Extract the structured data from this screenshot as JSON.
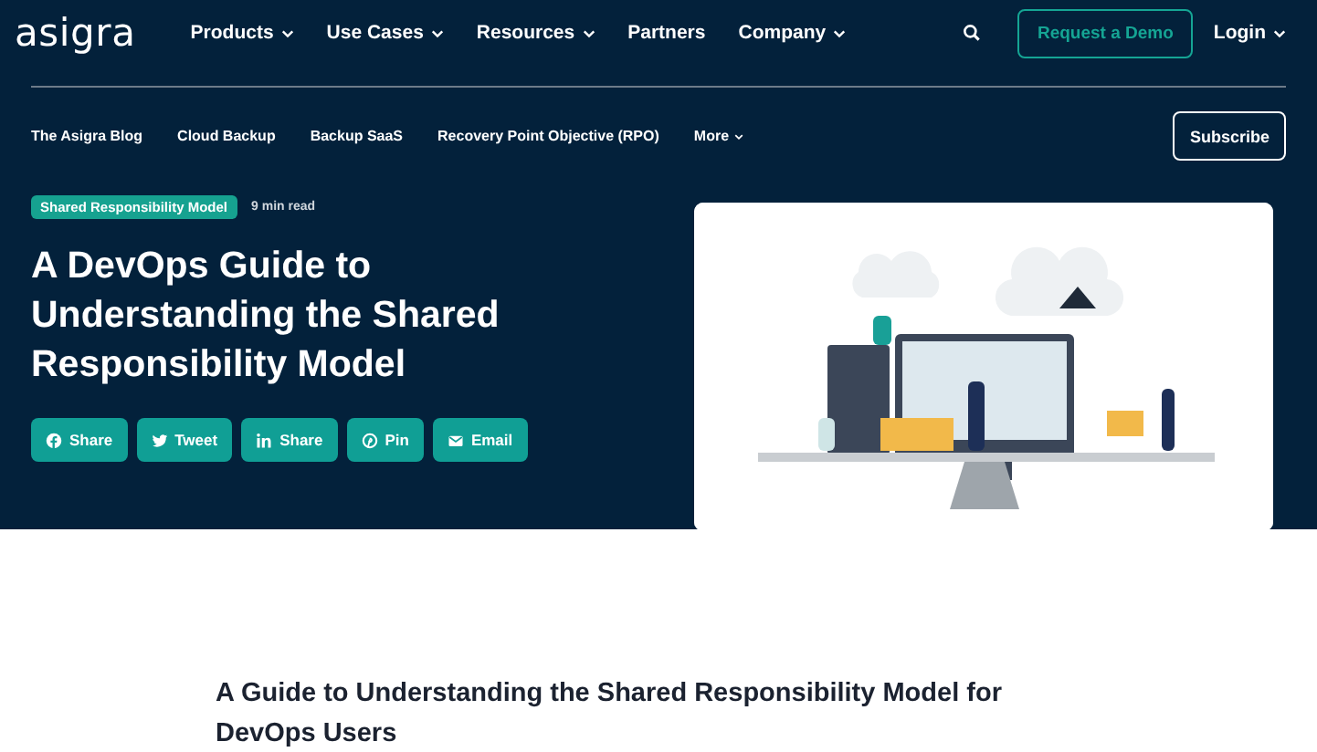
{
  "logo": "asigra",
  "nav": [
    {
      "label": "Products",
      "dropdown": true
    },
    {
      "label": "Use Cases",
      "dropdown": true
    },
    {
      "label": "Resources",
      "dropdown": true
    },
    {
      "label": "Partners",
      "dropdown": false
    },
    {
      "label": "Company",
      "dropdown": true
    }
  ],
  "demo_button": "Request a Demo",
  "login": {
    "label": "Login",
    "dropdown": true
  },
  "subnav": [
    {
      "label": "The Asigra Blog",
      "dropdown": false
    },
    {
      "label": "Cloud Backup",
      "dropdown": false
    },
    {
      "label": "Backup SaaS",
      "dropdown": false
    },
    {
      "label": "Recovery Point Objective (RPO)",
      "dropdown": false
    },
    {
      "label": "More",
      "dropdown": true
    }
  ],
  "subscribe_button": "Subscribe",
  "article": {
    "tag": "Shared Responsibility Model",
    "read_time": "9 min read",
    "title": "A DevOps Guide to Understanding the Shared Responsibility Model",
    "share": [
      {
        "kind": "facebook",
        "label": "Share"
      },
      {
        "kind": "twitter",
        "label": "Tweet"
      },
      {
        "kind": "linkedin",
        "label": "Share"
      },
      {
        "kind": "pinterest",
        "label": "Pin"
      },
      {
        "kind": "email",
        "label": "Email"
      }
    ]
  },
  "subheading": "A Guide to Understanding the Shared Responsibility Model for DevOps Users"
}
